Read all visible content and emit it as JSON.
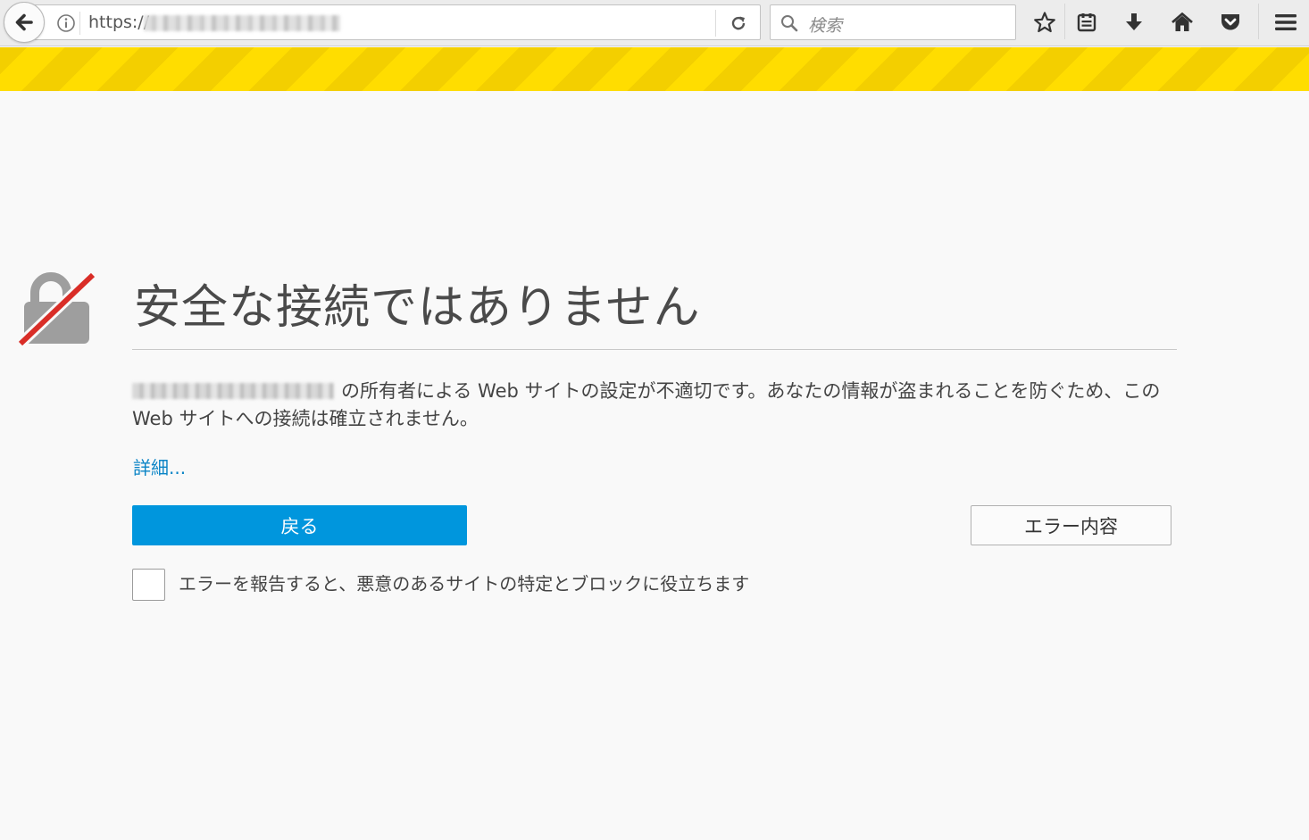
{
  "browser": {
    "url_prefix": "https://",
    "search_placeholder": "検索",
    "icons": {
      "back": "back-arrow-icon",
      "info": "info-icon",
      "reload": "reload-icon",
      "search": "search-icon",
      "bookmark": "star-icon",
      "library": "library-icon",
      "downloads": "download-arrow-icon",
      "home": "home-icon",
      "pocket": "pocket-icon",
      "menu": "hamburger-menu-icon"
    }
  },
  "colors": {
    "stripe_primary": "#ffdd00",
    "stripe_secondary": "#f3cf00",
    "primary_button": "#0096dd",
    "link": "#0a84c6",
    "lock_slash": "#d92d27",
    "lock_gray": "#9e9e9e"
  },
  "error": {
    "icon": "broken-lock-icon",
    "title": "安全な接続ではありません",
    "description": "の所有者による Web サイトの設定が不適切です。あなたの情報が盗まれることを防ぐため、この Web サイトへの接続は確立されません。",
    "advanced_link": "詳細...",
    "go_back_button": "戻る",
    "details_button": "エラー内容",
    "report_checkbox_label": "エラーを報告すると、悪意のあるサイトの特定とブロックに役立ちます"
  }
}
